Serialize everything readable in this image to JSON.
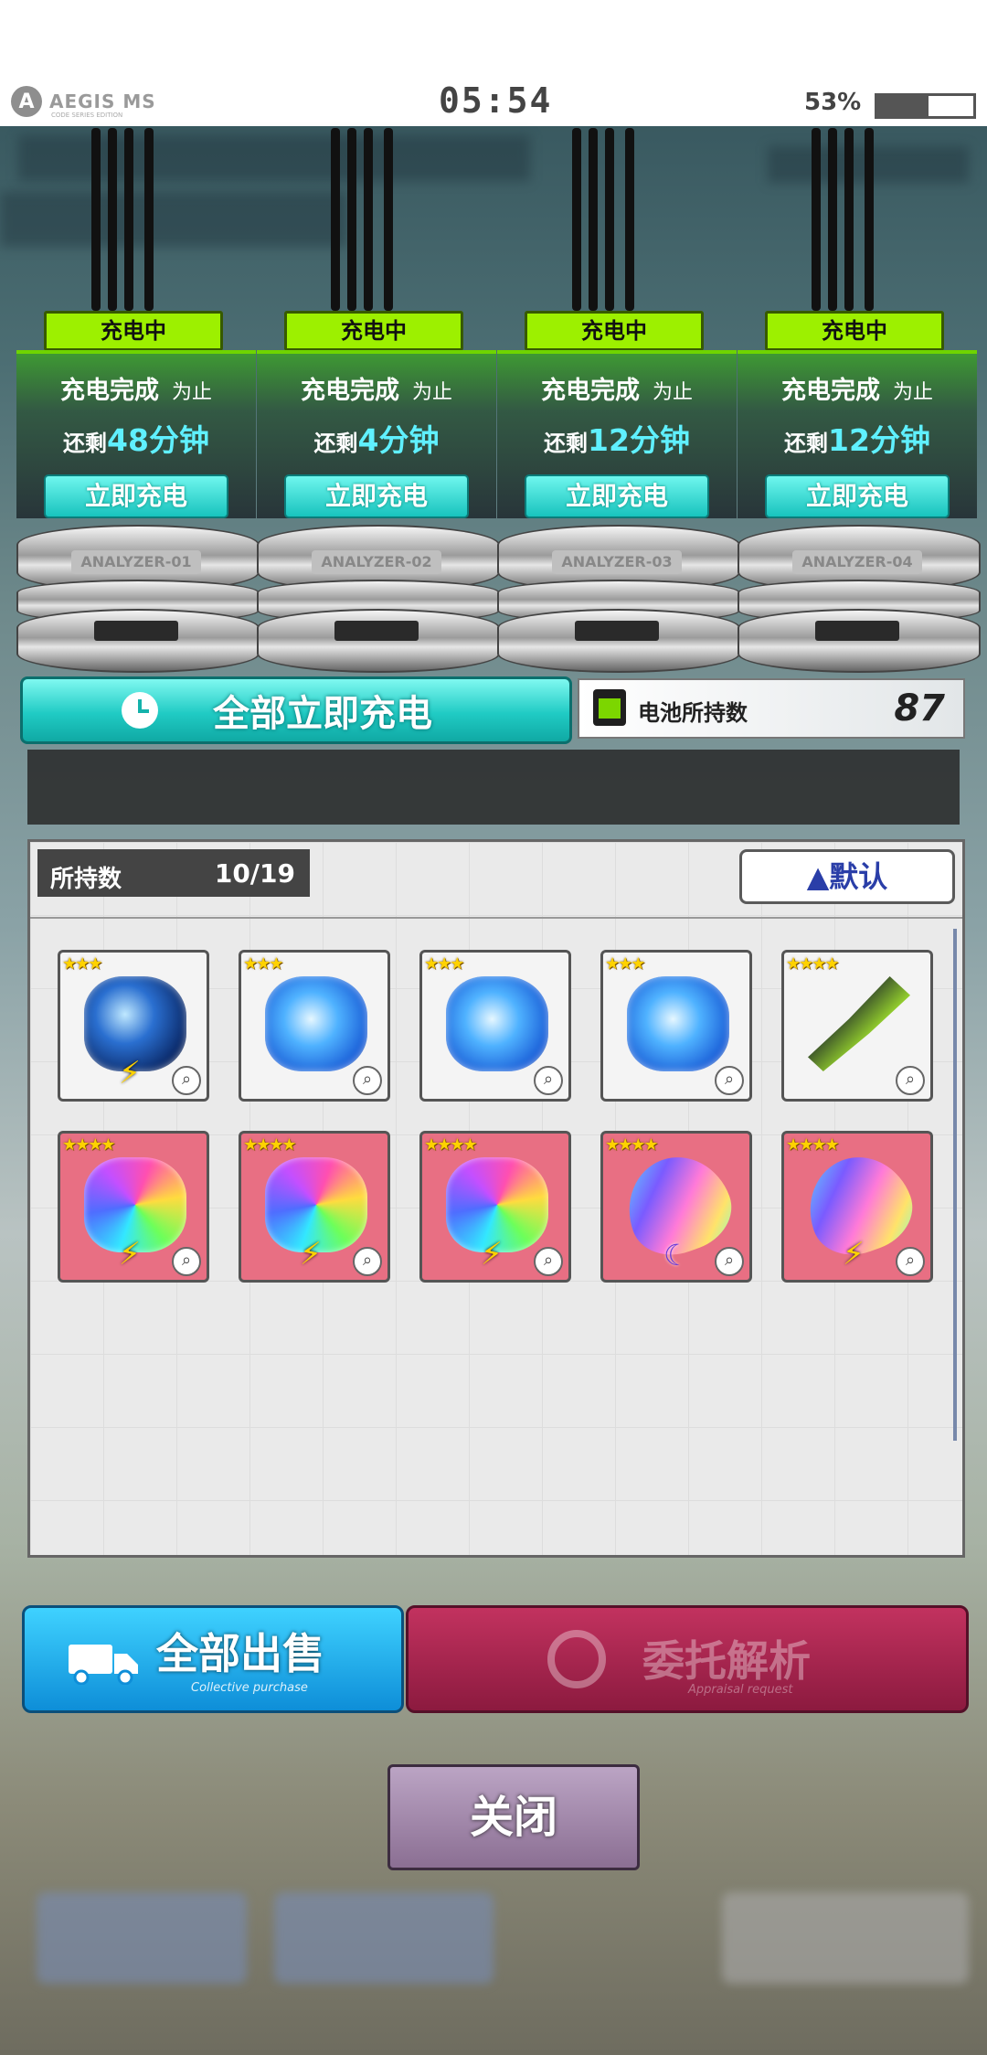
{
  "status_bar": {
    "app_logo_text": "AEGIS MS",
    "app_logo_sub": "CODE SERIES EDITION",
    "time": "05:54",
    "battery_percent": "53%",
    "battery_level": 0.53
  },
  "analyzers": [
    {
      "status": "充电中",
      "complete_text": "充电完成",
      "until_text": "为止",
      "remain_prefix": "还剩",
      "remain_value": "48分钟",
      "button": "立即充电",
      "device_label": "ANALYZER-01"
    },
    {
      "status": "充电中",
      "complete_text": "充电完成",
      "until_text": "为止",
      "remain_prefix": "还剩",
      "remain_value": "4分钟",
      "button": "立即充电",
      "device_label": "ANALYZER-02"
    },
    {
      "status": "充电中",
      "complete_text": "充电完成",
      "until_text": "为止",
      "remain_prefix": "还剩",
      "remain_value": "12分钟",
      "button": "立即充电",
      "device_label": "ANALYZER-03"
    },
    {
      "status": "充电中",
      "complete_text": "充电完成",
      "until_text": "为止",
      "remain_prefix": "还剩",
      "remain_value": "12分钟",
      "button": "立即充电",
      "device_label": "ANALYZER-04"
    }
  ],
  "all_charge": {
    "label": "全部立即充电"
  },
  "battery_holding": {
    "label": "电池所持数",
    "value": "87"
  },
  "list": {
    "owned_label": "所持数",
    "owned_count": "10/19",
    "sort_label": "▲默认",
    "items": [
      {
        "stars": "★★★",
        "rarity": "r3",
        "kind": "blue-dark",
        "badge": "⚡"
      },
      {
        "stars": "★★★",
        "rarity": "r3",
        "kind": "blue",
        "badge": ""
      },
      {
        "stars": "★★★",
        "rarity": "r3",
        "kind": "blue",
        "badge": ""
      },
      {
        "stars": "★★★",
        "rarity": "r3",
        "kind": "blue",
        "badge": ""
      },
      {
        "stars": "★★★★",
        "rarity": "r4w",
        "kind": "green-conch",
        "badge": ""
      },
      {
        "stars": "★★★★",
        "rarity": "r4p",
        "kind": "rainbow",
        "badge": "⚡"
      },
      {
        "stars": "★★★★",
        "rarity": "r4p",
        "kind": "rainbow",
        "badge": "⚡"
      },
      {
        "stars": "★★★★",
        "rarity": "r4p",
        "kind": "rainbow",
        "badge": "⚡"
      },
      {
        "stars": "★★★★",
        "rarity": "r4p",
        "kind": "rainbow-shell",
        "badge": "☾"
      },
      {
        "stars": "★★★★",
        "rarity": "r4p",
        "kind": "rainbow-shell",
        "badge": "⚡"
      }
    ]
  },
  "buttons": {
    "sell_all": "全部出售",
    "sell_all_sub": "Collective purchase",
    "consign": "委托解析",
    "consign_sub": "Appraisal request",
    "close": "关闭"
  },
  "colors": {
    "accent_teal": "#20cbc4",
    "charging_green": "#9df000",
    "sell_blue": "#0e8ed8",
    "consign_red": "#8c1a3f"
  }
}
